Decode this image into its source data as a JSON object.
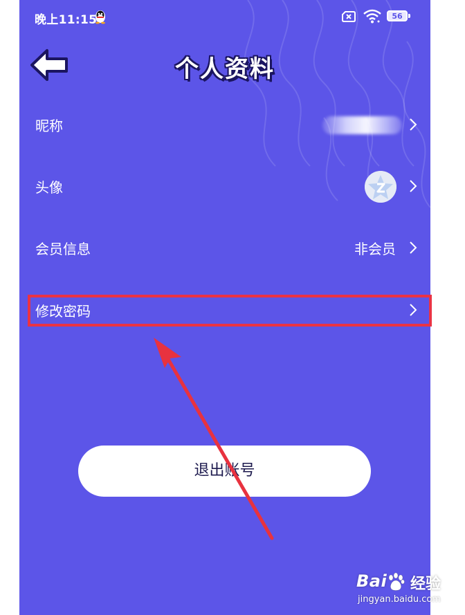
{
  "status_bar": {
    "time": "晚上11:15",
    "battery": "56"
  },
  "header": {
    "title": "个人资料"
  },
  "rows": [
    {
      "label": "昵称",
      "value": ""
    },
    {
      "label": "头像",
      "value": ""
    },
    {
      "label": "会员信息",
      "value": "非会员"
    },
    {
      "label": "修改密码",
      "value": ""
    }
  ],
  "logout_button": {
    "label": "退出账号"
  },
  "watermark": {
    "brand": "Bai",
    "brand_cn": "经验",
    "url": "jingyan.baidu.com"
  },
  "colors": {
    "background": "#5c55e8",
    "highlight": "#ea3344",
    "annotation_arrow": "#e8323f"
  }
}
